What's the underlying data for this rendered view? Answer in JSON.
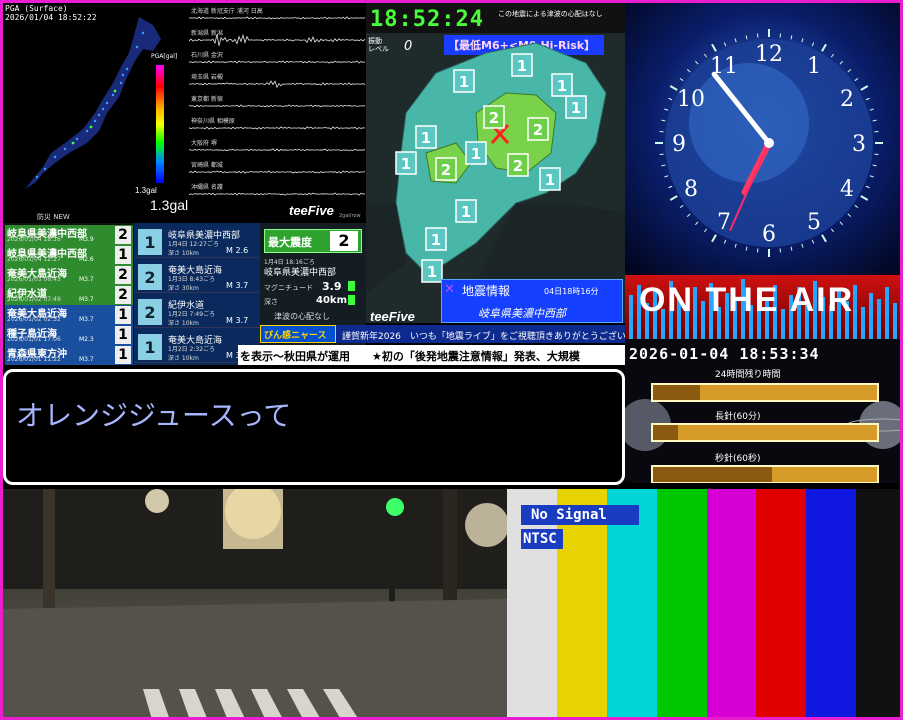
{
  "pga_panel": {
    "header_line1": "PGA (Surface)",
    "header_line2": "2026/01/04 18:52:22",
    "scale_title": "PGA[gal]",
    "peak_small": "1.3gal",
    "peak_big": "1.3gal",
    "footer": "防災 NEW"
  },
  "wave_panel": {
    "stations": [
      "北海道 新冠支庁 浦河 日高",
      "新潟県 新潟",
      "石川県 金沢",
      "埼玉県 岩槻",
      "東京都 新宿",
      "神奈川県 相模原",
      "大阪府 堺",
      "宮崎県 都城",
      "沖縄県 名護"
    ],
    "logo": "teeFive",
    "scale": "2gal/row"
  },
  "intensity_map": {
    "clock": "18:52:24",
    "tsunami_text": "この地震による津波の心配はなし",
    "level_label": "振動\nレベル",
    "level_value": "0",
    "risk_badge": "【最低M6+<M9 Hi-Risk】",
    "logo": "teeFive",
    "eq_title": "地震情報",
    "eq_date": "04日18時16分",
    "eq_place": "岐阜県美濃中西部",
    "marks": [
      {
        "v": "1"
      },
      {
        "v": "1"
      },
      {
        "v": "1"
      },
      {
        "v": "1"
      },
      {
        "v": "1"
      },
      {
        "v": "2"
      },
      {
        "v": "2"
      },
      {
        "v": "2"
      },
      {
        "v": "2"
      },
      {
        "v": "1"
      },
      {
        "v": "1"
      },
      {
        "v": "1"
      },
      {
        "v": "1"
      },
      {
        "v": "1"
      },
      {
        "v": "1"
      }
    ]
  },
  "analog_clock": {
    "numerals": [
      "12",
      "1",
      "2",
      "3",
      "4",
      "5",
      "6",
      "7",
      "8",
      "9",
      "10",
      "11"
    ],
    "hour_h": 18,
    "hour_m": 53,
    "hour_s": 34
  },
  "on_air": {
    "text": "ON THE AIR"
  },
  "timer": {
    "datetime": "2026-01-04 18:53:34",
    "labels": [
      "24時間残り時間",
      "長針(60分)",
      "秒針(60秒)"
    ],
    "fractions": [
      0.21,
      0.11,
      0.53
    ]
  },
  "quake_list": [
    {
      "place": "岐阜県美濃中西部",
      "time": "2026/01/04 18:16",
      "mag": "M3.9",
      "int": "2",
      "color": "#2e8b2e"
    },
    {
      "place": "岐阜県美濃中西部",
      "time": "2026/01/04 12:27",
      "mag": "M2.6",
      "int": "1",
      "color": "#2e8b2e"
    },
    {
      "place": "奄美大島近海",
      "time": "2026/01/03 08:43",
      "mag": "M3.7",
      "int": "2",
      "color": "#2e8b2e"
    },
    {
      "place": "紀伊水道",
      "time": "2026/01/02 07:49",
      "mag": "M3.7",
      "int": "2",
      "color": "#2e8b2e"
    },
    {
      "place": "奄美大島近海",
      "time": "2026/01/02 02:32",
      "mag": "M3.7",
      "int": "1",
      "color": "#1a4f9e"
    },
    {
      "place": "種子島近海",
      "time": "2026/01/01 17:06",
      "mag": "M2.3",
      "int": "1",
      "color": "#1a4f9e"
    },
    {
      "place": "青森県東方沖",
      "time": "2026/01/01 11:22",
      "mag": "M3.7",
      "int": "1",
      "color": "#1a4f9e"
    }
  ],
  "quake_detail": [
    {
      "int": "1",
      "place": "岐阜県美濃中西部",
      "time": "1月4日 12:27ごろ",
      "depth": "深さ 10km",
      "mag": "M 2.6"
    },
    {
      "int": "2",
      "place": "奄美大島近海",
      "time": "1月3日 8:43ごろ",
      "depth": "深さ 30km",
      "mag": "M 3.7"
    },
    {
      "int": "2",
      "place": "紀伊水道",
      "time": "1月2日 7:49ごろ",
      "depth": "深さ 10km",
      "mag": "M 3.7"
    },
    {
      "int": "1",
      "place": "奄美大島近海",
      "time": "1月2日 2:32ごろ",
      "depth": "深さ 10km",
      "mag": "M 3.7"
    }
  ],
  "max_intensity": {
    "label": "最大震度",
    "value": "2",
    "time": "1月4日 18:16ごろ",
    "place": "岐阜県美濃中西部",
    "mag_label": "マグニチュード",
    "mag_value": "3.9",
    "depth_label": "深さ",
    "depth_value": "40km",
    "tsunami": "津波の心配なし"
  },
  "ticker1": {
    "badge": "ぴん感ニャース",
    "text": "謹賀新年2026　いつも「地震ライブ」をご視聴頂きありがとうございます!"
  },
  "ticker2": {
    "text": "を表示〜秋田県が運用　　★初の「後発地震注意情報」発表、大規模"
  },
  "caption": {
    "text": "オレンジジュースって"
  },
  "color_bars": {
    "no_signal": "No Signal",
    "ntsc": "NTSC",
    "colors": [
      "#e0e0e0",
      "#e7d300",
      "#00d6d6",
      "#00c800",
      "#d600d6",
      "#e00000",
      "#1018e0",
      "#101010"
    ]
  }
}
